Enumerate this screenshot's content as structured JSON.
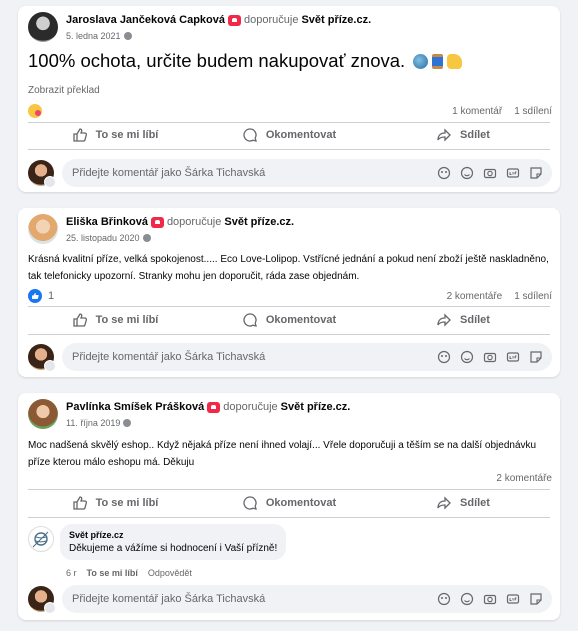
{
  "composer_placeholder": "Přidejte komentář jako Šárka Tichavská",
  "actions": {
    "like": "To se mi líbí",
    "comment": "Okomentovat",
    "share": "Sdílet"
  },
  "posts": [
    {
      "author": "Jaroslava Jančeková Capková",
      "recommends": "doporučuje",
      "page": "Svět příze.cz.",
      "date": "5. ledna 2021",
      "text": "100% ochota, určite budem nakupovať znova.",
      "translate": "Zobrazit překlad",
      "comments": "1 komentář",
      "shares": "1 sdílení"
    },
    {
      "author": "Eliška Břinková",
      "recommends": "doporučuje",
      "page": "Svět příze.cz.",
      "date": "25. listopadu 2020",
      "text": "Krásná kvalitní příze, velká spokojenost..... Eco Love-Lolipop. Vstřícné  jednání a pokud není zboží ještě naskladněno, tak telefonicky upozorní. Stranky mohu jen doporučit, ráda zase objednám.",
      "likes": "1",
      "comments": "2 komentáře",
      "shares": "1 sdílení"
    },
    {
      "author": "Pavlínka Smíšek Prášková",
      "recommends": "doporučuje",
      "page": "Svět příze.cz.",
      "date": "11. října 2019",
      "text": "Moc nadšená skvělý eshop.. Když nějaká příze není ihned volají... Vřele doporučuji a těším se na další objednávku příze kterou málo eshopu má. Děkuju",
      "comments": "2 komentáře",
      "reply": {
        "author": "Svět příze.cz",
        "text": "Děkujeme a vážíme si hodnocení i Vaší přízně!",
        "age": "6 r",
        "like": "To se mi líbí",
        "respond": "Odpovědět"
      }
    }
  ]
}
